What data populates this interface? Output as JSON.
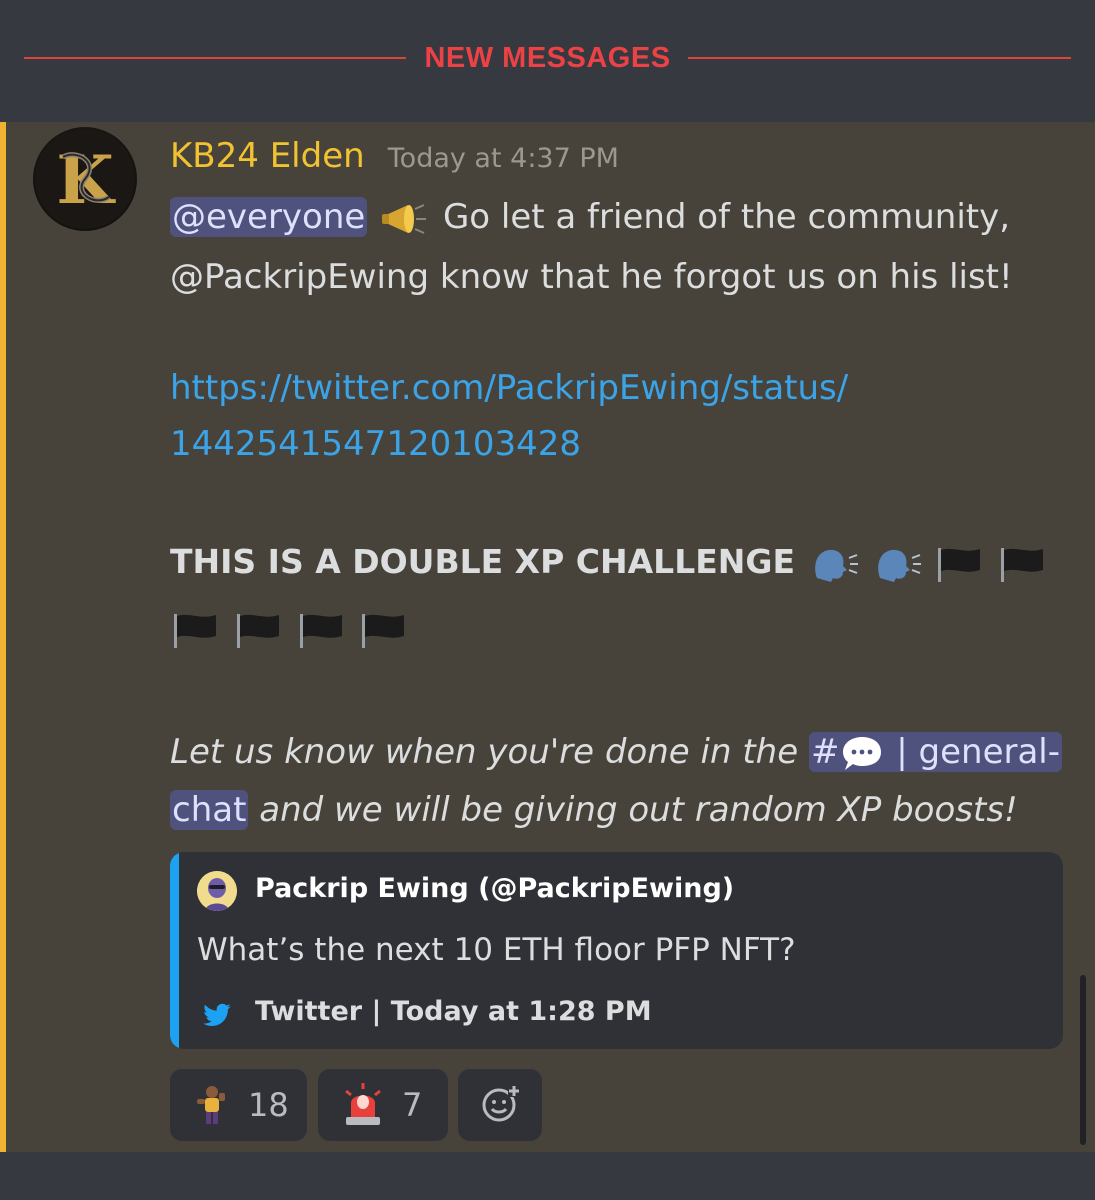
{
  "divider": {
    "label": "NEW MESSAGES"
  },
  "message": {
    "author": "KB24 Elden",
    "timestamp": "Today at 4:37 PM",
    "mention": "@everyone",
    "line1_text": " Go let a friend of the community,",
    "line2_text": "@PackripEwing know that he forgot us on his list!",
    "link_line1": "https://twitter.com/PackripEwing/status/",
    "link_line2": "1442541547120103428",
    "challenge_text": "THIS IS A DOUBLE XP CHALLENGE",
    "italic_part1": "Let us know when you're done in the",
    "channel_hash": "#",
    "channel_name_part1": " | general-",
    "channel_name_part2": "chat",
    "italic_part2": " and we will be giving out random XP boosts!"
  },
  "embed": {
    "author": "Packrip Ewing (@PackripEwing)",
    "description": "What’s the next 10 ETH floor PFP NFT?",
    "footer": "Twitter | Today at 1:28 PM",
    "accent_color": "#1da1f2"
  },
  "reactions": [
    {
      "emoji": "custom-player-emoji",
      "count": "18"
    },
    {
      "emoji": "police-light-emoji",
      "count": "7"
    },
    {
      "emoji": "add-reaction-icon",
      "count": ""
    }
  ],
  "colors": {
    "background": "#36393f",
    "highlight": "#47433a",
    "accent": "#f0b232",
    "new_messages": "#ed4245",
    "link": "#3ba4e9",
    "mention_bg": "#4f527d"
  }
}
